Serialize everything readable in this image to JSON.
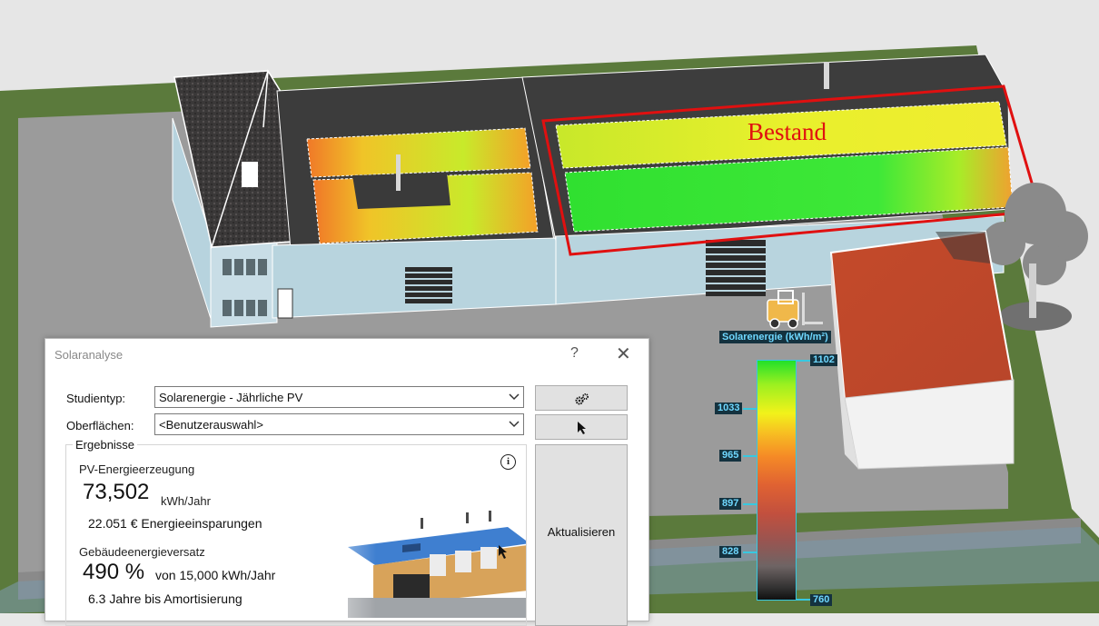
{
  "scene": {
    "overlay_label": "Bestand",
    "colors": {
      "ground": "#5b7a3c",
      "pavement": "#9a9a9a",
      "wall": "#b8d4de",
      "roof_dark": "#444444",
      "highlight": "#e01010"
    }
  },
  "legend": {
    "title": "Solarenergie (kWh/m²)",
    "max": 1102,
    "min": 760,
    "ticks": [
      "1102",
      "1033",
      "965",
      "897",
      "828",
      "760"
    ]
  },
  "dialog": {
    "title": "Solaranalyse",
    "help_label": "?",
    "close_label": "✕",
    "study_type_label": "Studientyp:",
    "study_type_value": "Solarenergie - Jährliche PV",
    "surfaces_label": "Oberflächen:",
    "surfaces_value": "<Benutzerauswahl>",
    "results_group": "Ergebnisse",
    "pv_heading": "PV-Energieerzeugung",
    "pv_value": "73,502",
    "pv_unit": "kWh/Jahr",
    "savings": "22.051 € Energieeinsparungen",
    "offset_heading": "Gebäudeenergieversatz",
    "offset_value": "490 %",
    "offset_of": "von 15,000 kWh/Jahr",
    "payback": "6.3 Jahre bis Amortisierung",
    "update_button": "Aktualisieren",
    "info_glyph": "i"
  }
}
